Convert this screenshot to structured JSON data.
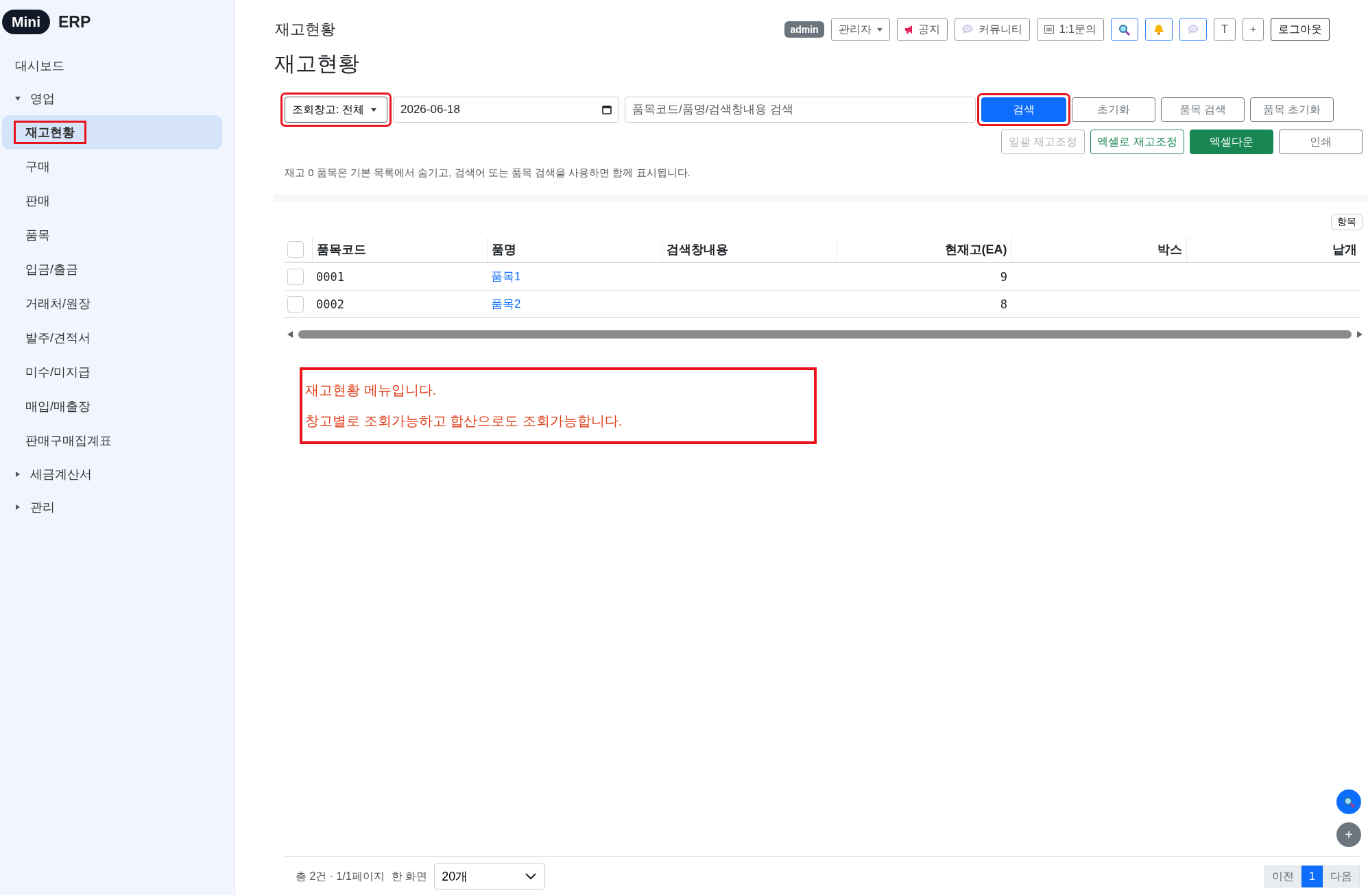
{
  "brand": {
    "badge": "Mini",
    "name": "ERP"
  },
  "sidebar": {
    "items": [
      {
        "label": "대시보드",
        "kind": "link"
      },
      {
        "label": "영업",
        "kind": "group",
        "expanded": true,
        "children": [
          {
            "label": "재고현황",
            "selected": true,
            "highlighted": true
          },
          {
            "label": "구매",
            "selected": false,
            "highlighted": false
          },
          {
            "label": "판매",
            "selected": false,
            "highlighted": false
          },
          {
            "label": "품목",
            "selected": false,
            "highlighted": false
          },
          {
            "label": "입금/출금",
            "selected": false,
            "highlighted": false
          },
          {
            "label": "거래처/원장",
            "selected": false,
            "highlighted": false
          },
          {
            "label": "발주/견적서",
            "selected": false,
            "highlighted": false
          },
          {
            "label": "미수/미지급",
            "selected": false,
            "highlighted": false
          },
          {
            "label": "매입/매출장",
            "selected": false,
            "highlighted": false
          },
          {
            "label": "판매구매집계표",
            "selected": false,
            "highlighted": false
          }
        ]
      },
      {
        "label": "세금계산서",
        "kind": "group",
        "expanded": false
      },
      {
        "label": "관리",
        "kind": "group",
        "expanded": false
      }
    ]
  },
  "header": {
    "title": "재고현황",
    "user_badge": "admin",
    "buttons": [
      {
        "kind": "dropdown",
        "label": "관리자"
      },
      {
        "kind": "notice",
        "label": "공지"
      },
      {
        "kind": "community",
        "label": "커뮤니티"
      },
      {
        "kind": "inquiry",
        "label": "1:1문의"
      },
      {
        "kind": "search"
      },
      {
        "kind": "alerts"
      },
      {
        "kind": "chat"
      },
      {
        "kind": "text",
        "label": "T"
      },
      {
        "kind": "text",
        "label": "+"
      },
      {
        "kind": "logout",
        "label": "로그아웃"
      }
    ]
  },
  "page_title": "재고현황",
  "filters": {
    "warehouse": {
      "label": "조회창고: 전체",
      "highlighted": true
    },
    "date": "2026-06-18",
    "search": {
      "placeholder": "품목코드/품명/검색창내용 검색"
    },
    "buttons": [
      {
        "label": "검색",
        "kind": "primary",
        "highlighted": true
      },
      {
        "label": "초기화",
        "kind": "outline",
        "highlighted": false
      },
      {
        "label": "품목 검색",
        "kind": "outline",
        "highlighted": false
      },
      {
        "label": "품목 초기화",
        "kind": "outline",
        "highlighted": false
      }
    ],
    "actions": [
      {
        "label": "일괄 재고조정",
        "kind": "outline",
        "disabled": true
      },
      {
        "label": "엑셀로 재고조정",
        "kind": "outline-success",
        "disabled": false
      },
      {
        "label": "엑셀다운",
        "kind": "success",
        "disabled": false
      },
      {
        "label": "인쇄",
        "kind": "outline",
        "disabled": false
      }
    ]
  },
  "note": "재고 0 품목은 기본 목록에서 숨기고, 검색어 또는 품목 검색을 사용하면 함께 표시됩니다.",
  "table": {
    "columns_button": "항목",
    "select_all_checked": false,
    "columns": [
      {
        "label": "품목코드",
        "kind": "code"
      },
      {
        "label": "품명",
        "kind": "link"
      },
      {
        "label": "검색창내용",
        "kind": "text"
      },
      {
        "label": "현재고(EA)",
        "kind": "number"
      },
      {
        "label": "박스",
        "kind": "number"
      },
      {
        "label": "낱개",
        "kind": "number"
      }
    ],
    "rows": [
      {
        "checked": false,
        "cells": [
          "0001",
          "품목1",
          null,
          "9",
          null,
          null
        ]
      },
      {
        "checked": false,
        "cells": [
          "0002",
          "품목2",
          null,
          "8",
          null,
          null
        ]
      }
    ]
  },
  "annotation": {
    "lines": [
      "재고현황 메뉴입니다.",
      "창고별로 조회가능하고 합산으로도 조회가능합니다."
    ]
  },
  "footer": {
    "summary": "총 2건 · 1/1페이지",
    "per_page_label": "한 화면",
    "per_page": "20개",
    "prev": "이전",
    "pages": [
      {
        "label": "1",
        "selected": true
      }
    ],
    "next": "다음"
  },
  "fabs": [
    {
      "kind": "search"
    },
    {
      "kind": "plus",
      "label": "+"
    }
  ]
}
